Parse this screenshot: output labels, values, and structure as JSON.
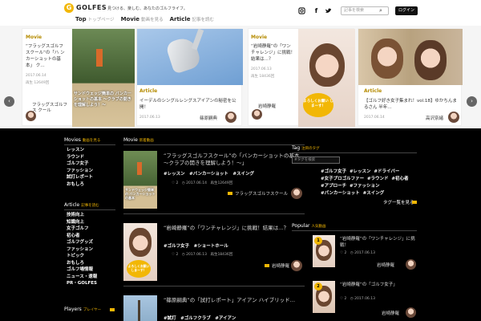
{
  "header": {
    "logo_letter": "G",
    "logo_text": "GOLFES",
    "tagline": "見つける、楽しむ、あなたのゴルフライフ。",
    "nav": [
      {
        "label": "Top",
        "sub": "トップページ"
      },
      {
        "label": "Movie",
        "sub": "動画を見る"
      },
      {
        "label": "Article",
        "sub": "記事を読む"
      }
    ],
    "search_placeholder": "記事を検索",
    "login_label": "ログイン"
  },
  "carousel": {
    "cards": [
      {
        "category": "Movie",
        "title": "“フラッグスゴルフスクール”の「ハ ンカーショットの基本」 ク…",
        "date": "2017.06.14",
        "views": "再生 12649回",
        "author": "フラッグスゴルフス クール",
        "overlay": "サンドウェッジ簡単の バンカーショットの基本 〜クラブの開きを理解しよう！〜"
      },
      {
        "category": "Article",
        "title": "イーデルのシングルレングスアイアンの秘密を公開！",
        "date": "2017.06.13",
        "author": "篠原嗣典"
      },
      {
        "category": "Movie",
        "title": "“岩崎静羅”の「ワン チャレンジ」に挑戦！結果は…？",
        "date": "2017.06.13",
        "views": "再生 18436回",
        "author": "岩崎静羅",
        "overlay": "よろしくお願い しまーす！"
      },
      {
        "category": "Article",
        "title": "【ゴルフ好き女子集まれ！vol.18】ゆかちんまるさん 半年…",
        "date": "2017.06.14",
        "author": "高沢奈緒"
      }
    ]
  },
  "sidebar": {
    "movies_heading": "Movies",
    "movies_heading_sub": "動画を見る",
    "movies": [
      "レッスン",
      "ラウンド",
      "ゴルフ女子",
      "ファッション",
      "試打レポート",
      "おもしろ"
    ],
    "articles_heading": "Article",
    "articles_heading_sub": "記事を読む",
    "articles": [
      "技術向上",
      "知識向上",
      "女子ゴルフ",
      "初心者",
      "ゴルフグッズ",
      "ファッション",
      "トピック",
      "おもしろ",
      "ゴルフ場情報",
      "ニュース・速報",
      "PR・GOLFES"
    ],
    "players_heading": "Players",
    "players_heading_sub": "プレイヤー"
  },
  "main": {
    "heading": "Movie",
    "heading_sub": "新着動画",
    "posts": [
      {
        "title": "“フラッグスゴルフスクール”の「バンカーショットの基本 ～クラブの開きを理解しよう！～」",
        "tags": "#レッスン　#バンカーショット　#スイング",
        "meta": "♡ 2　◷ 2017.06.14　再生12649回",
        "author": "フラッグスゴルフスクール",
        "thumb_text": "サンドウェッジ簡単の バンカーショットの基本"
      },
      {
        "title": "“岩崎静羅”の「ワンチャレンジ」に挑戦！結果は…？",
        "tags": "#ゴルフ女子　#ショートホール",
        "meta": "♡ 2　◷ 2017.06.13　再生18436回",
        "author": "岩崎静羅",
        "thumb_text": "よろしくお願い しまーす！"
      },
      {
        "title": "“篠原嗣典”の「試打レポート」アイアン ハイブリッド…",
        "tags": "#試打　#ゴルフクラブ　#アイアン",
        "meta": "",
        "author": ""
      }
    ]
  },
  "right": {
    "tags_heading": "Tag",
    "tags_heading_sub": "注目のタグ",
    "tag_search_placeholder": "#タグを検索",
    "tags": [
      "#ゴルフ女子",
      "#レッスン",
      "#ドライバー",
      "#女子プロゴルファー",
      "#ラウンド",
      "#初心者",
      "#アプローチ",
      "#ファッション",
      "#パンカーショット",
      "#スイング"
    ],
    "tags_more": "タグ一覧を見る",
    "popular_heading": "Popular",
    "popular_heading_sub": "人気動画",
    "popular": [
      {
        "rank": "1",
        "title": "“岩崎静羅”の「ワンチャレンジ」に挑戦！",
        "meta": "♡ 2　◷ 2017.06.13",
        "author": "岩崎静羅"
      },
      {
        "rank": "2",
        "title": "“岩崎静羅”の「ゴルフ女子」",
        "meta": "♡ 2　◷ 2017.06.13",
        "author": "岩崎静羅"
      }
    ]
  }
}
